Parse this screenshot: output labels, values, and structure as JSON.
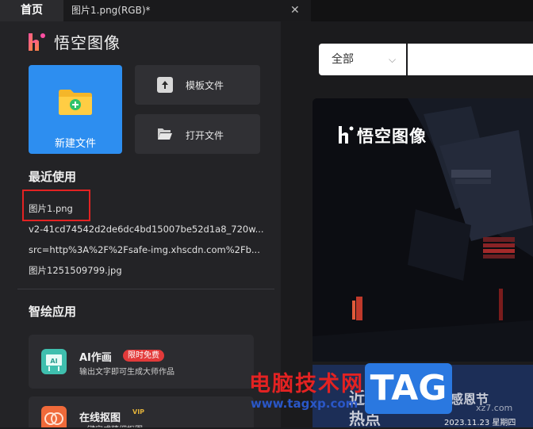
{
  "tabs": {
    "home": "首页",
    "document": "图片1.png(RGB)*",
    "close_glyph": "✕"
  },
  "app": {
    "name": "悟空图像"
  },
  "actions": {
    "new_file": "新建文件",
    "template_file": "模板文件",
    "open_file": "打开文件"
  },
  "recent": {
    "title": "最近使用",
    "items": [
      "图片1.png",
      "v2-41cd74542d2de6dc4bd15007be52d1a8_720w...",
      "src=http%3A%2F%2Fsafe-img.xhscdn.com%2Fb...",
      "图片1251509799.jpg"
    ]
  },
  "smart_apps": {
    "title": "智绘应用",
    "items": [
      {
        "name": "AI作画",
        "badge": "限时免费",
        "desc": "输出文字即可生成大师作品"
      },
      {
        "name": "在线抠图",
        "badge": "VIP",
        "desc": "一键完成精细抠图"
      }
    ]
  },
  "right": {
    "filter_label": "全部",
    "banner_title": "悟空图像",
    "bottom_text_1": "近期",
    "bottom_text_2": "热点",
    "bottom_text_3": "感恩节"
  },
  "watermark": {
    "site_name": "电脑技术网",
    "url": "www.tagxp.com",
    "tag": "TAG",
    "date": "2023.11.23 星期四",
    "faint": "xz7.com"
  },
  "colors": {
    "accent_blue": "#2d8ef0",
    "highlight_red": "#e32222",
    "badge_red": "#e23a3a"
  }
}
